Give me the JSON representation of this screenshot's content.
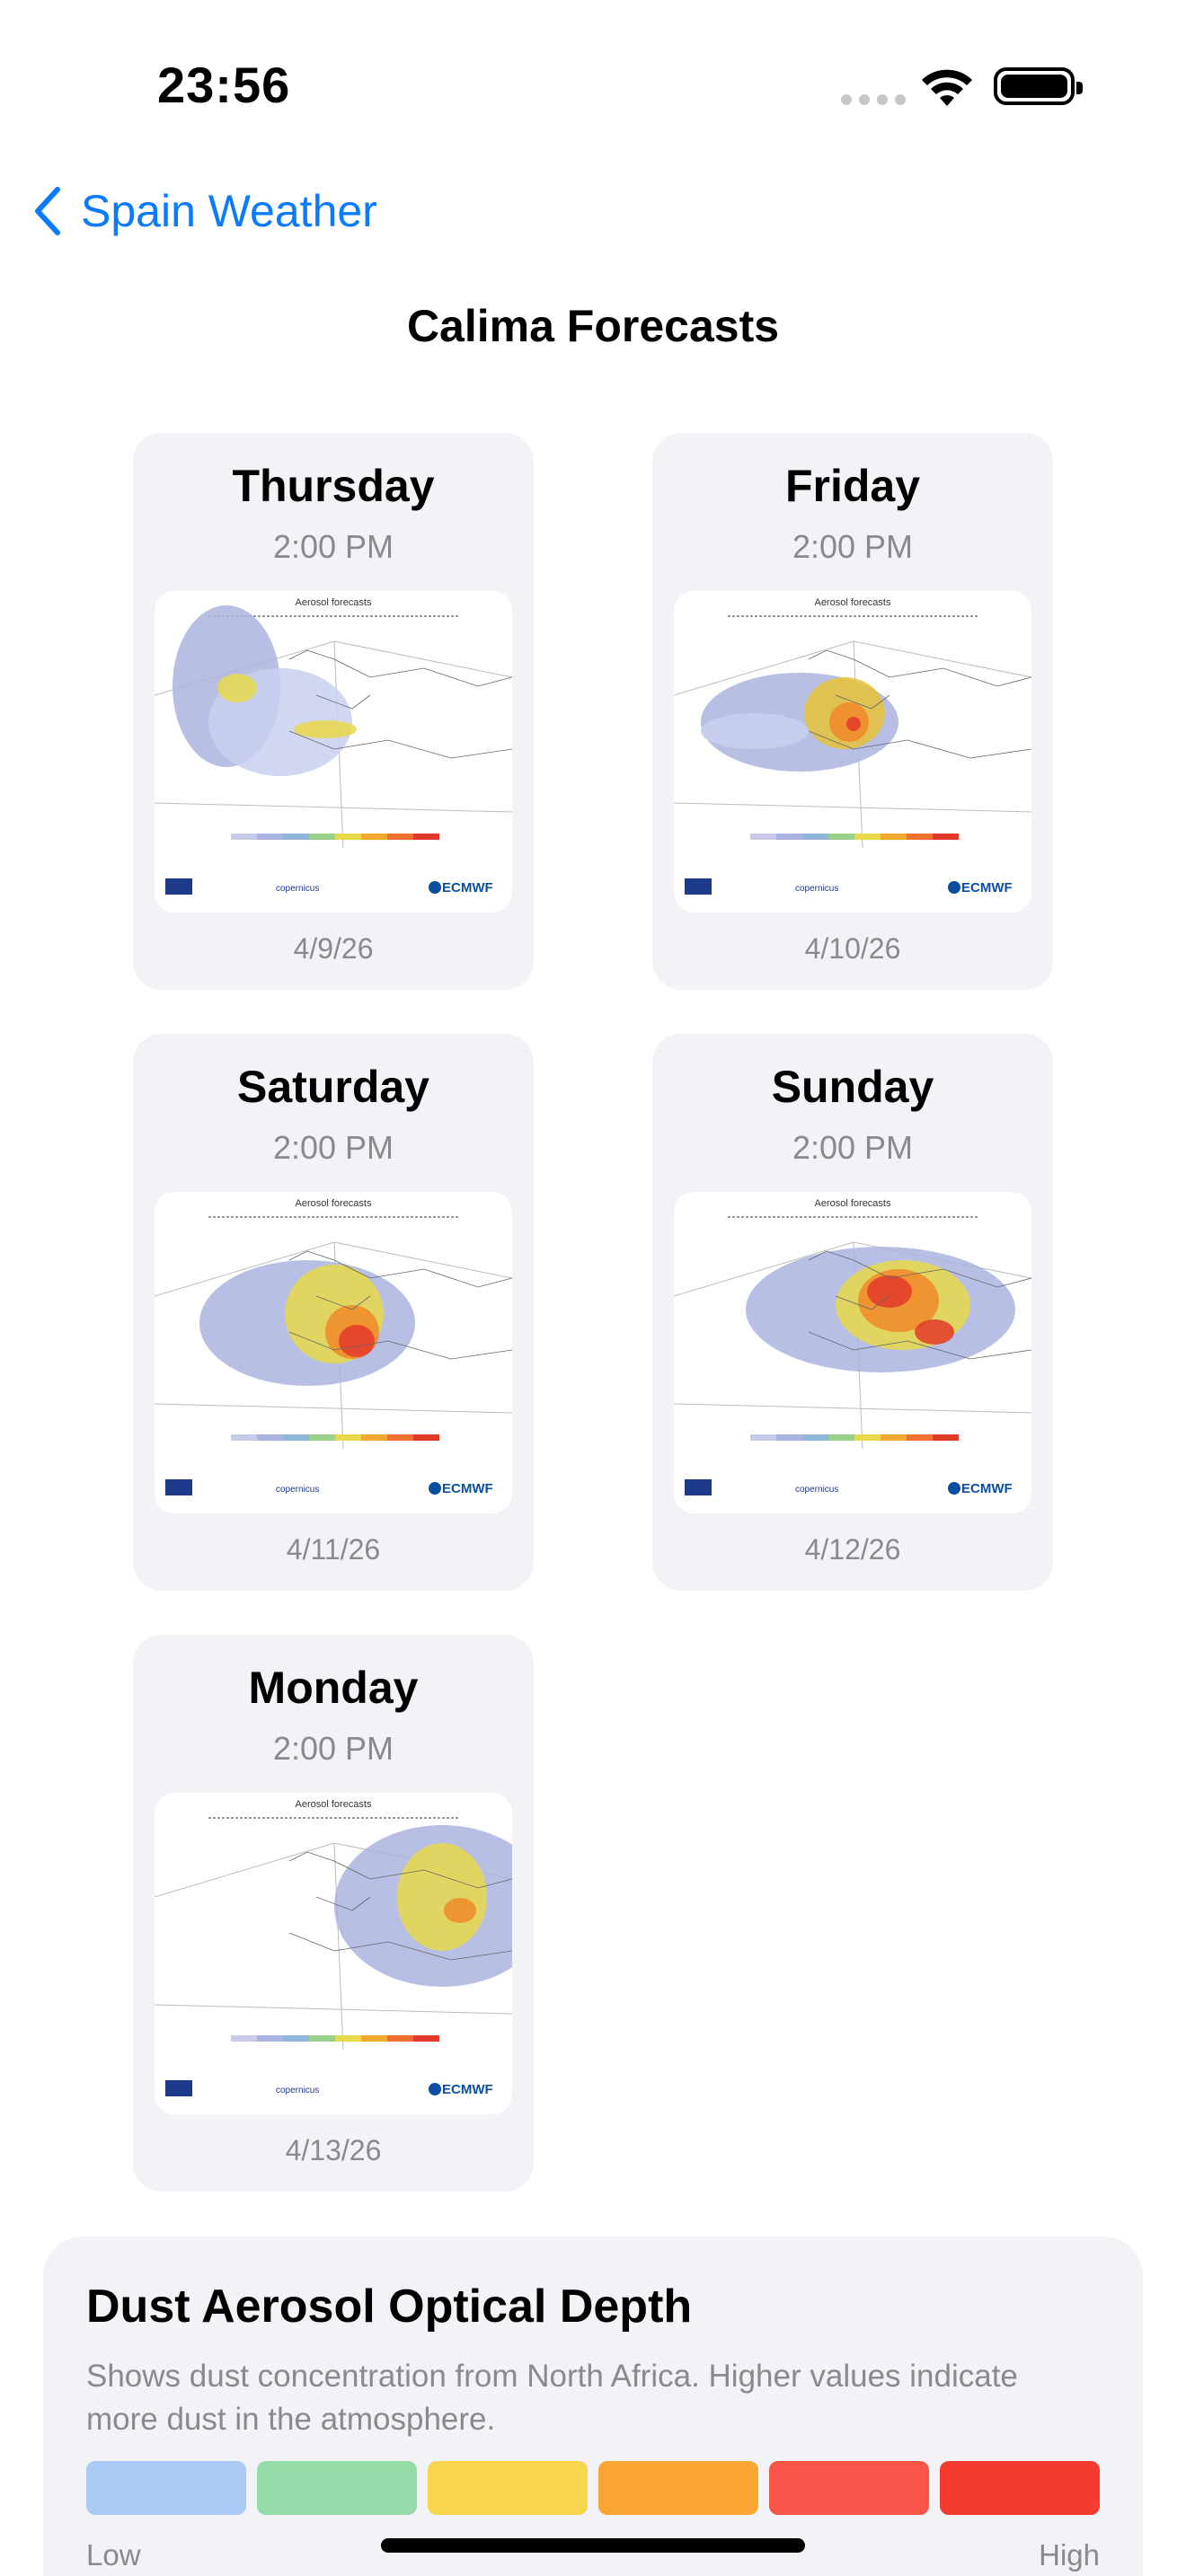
{
  "status": {
    "time": "23:56"
  },
  "nav": {
    "back_label": "Spain Weather"
  },
  "page": {
    "title": "Calima Forecasts"
  },
  "forecasts": [
    {
      "day": "Thursday",
      "time": "2:00 PM",
      "date": "4/9/26",
      "map_title": "Aerosol forecasts",
      "logo": "ECMWF"
    },
    {
      "day": "Friday",
      "time": "2:00 PM",
      "date": "4/10/26",
      "map_title": "Aerosol forecasts",
      "logo": "ECMWF"
    },
    {
      "day": "Saturday",
      "time": "2:00 PM",
      "date": "4/11/26",
      "map_title": "Aerosol forecasts",
      "logo": "ECMWF"
    },
    {
      "day": "Sunday",
      "time": "2:00 PM",
      "date": "4/12/26",
      "map_title": "Aerosol forecasts",
      "logo": "ECMWF"
    },
    {
      "day": "Monday",
      "time": "2:00 PM",
      "date": "4/13/26",
      "map_title": "Aerosol forecasts",
      "logo": "ECMWF"
    }
  ],
  "info": {
    "title": "Dust Aerosol Optical Depth",
    "description": "Shows dust concentration from North Africa. Higher values indicate more dust in the atmosphere.",
    "low_label": "Low",
    "high_label": "High",
    "scale_colors": [
      "#a9cbf5",
      "#96dca8",
      "#f7d54c",
      "#f8a631",
      "#f75547",
      "#f43b2f"
    ]
  },
  "colors": {
    "accent": "#0a7aff",
    "card_bg": "#f2f2f7",
    "secondary_text": "#8a8a8e"
  }
}
